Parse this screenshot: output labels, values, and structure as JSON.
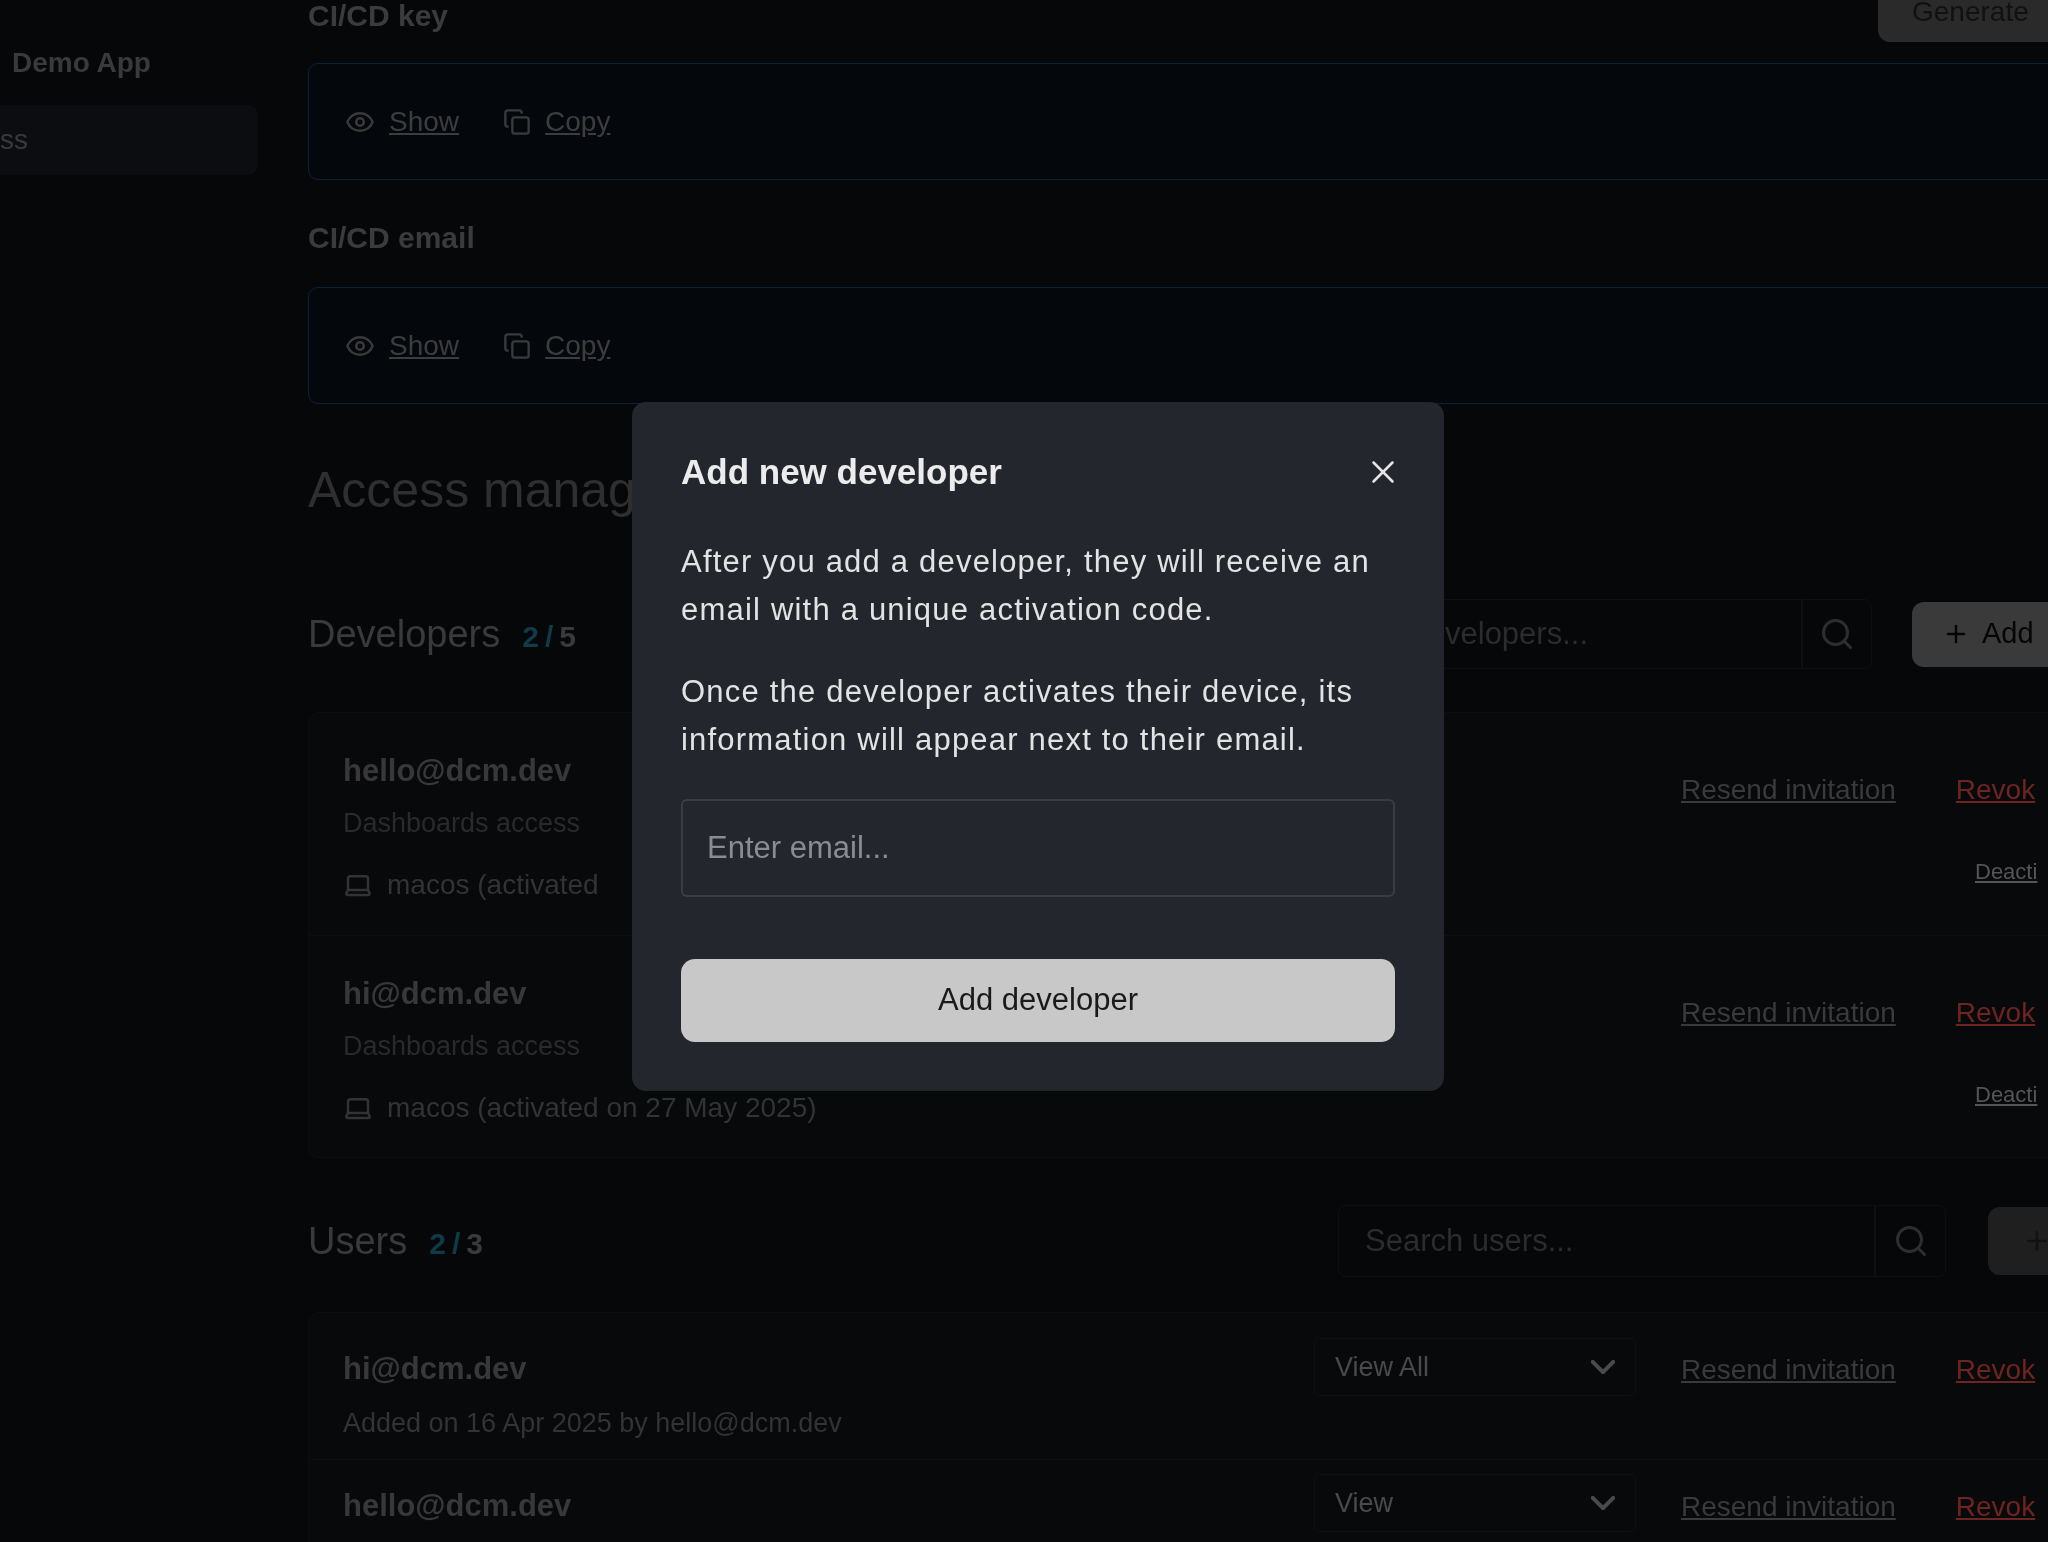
{
  "sidebar": {
    "app_name": "Demo App",
    "items": [
      {
        "label": "ss",
        "selected": true
      }
    ]
  },
  "cicd": {
    "generate_button": "Generate",
    "sections": [
      {
        "title": "CI/CD key",
        "show": "Show",
        "copy": "Copy"
      },
      {
        "title": "CI/CD email",
        "show": "Show",
        "copy": "Copy"
      }
    ]
  },
  "access": {
    "title": "Access manag",
    "developers": {
      "title": "Developers",
      "used": "2",
      "slash": "/",
      "limit": "5",
      "search_placeholder": "velopers...",
      "add_button": "Add",
      "rows": [
        {
          "email": "hello@dcm.dev",
          "access": "Dashboards access",
          "device": "macos (activated",
          "resend": "Resend invitation",
          "revoke": "Revok",
          "deactivate": "Deacti"
        },
        {
          "email": "hi@dcm.dev",
          "access": "Dashboards access",
          "device": "macos (activated on 27 May 2025)",
          "resend": "Resend invitation",
          "revoke": "Revok",
          "deactivate": "Deacti"
        }
      ]
    },
    "users": {
      "title": "Users",
      "used": "2",
      "slash": "/",
      "limit": "3",
      "search_placeholder": "Search users...",
      "rows": [
        {
          "email": "hi@dcm.dev",
          "added": "Added on 16 Apr 2025 by hello@dcm.dev",
          "role": "View All",
          "resend": "Resend invitation",
          "revoke": "Revok"
        },
        {
          "email": "hello@dcm.dev",
          "role": "View",
          "resend": "Resend invitation",
          "revoke": "Revok"
        }
      ]
    }
  },
  "modal": {
    "title": "Add new developer",
    "paragraphs": [
      "After you add a developer, they will receive an email with a unique activation code.",
      "Once the developer activates their device, its information will appear next to their email."
    ],
    "email_placeholder": "Enter email...",
    "submit": "Add developer"
  }
}
